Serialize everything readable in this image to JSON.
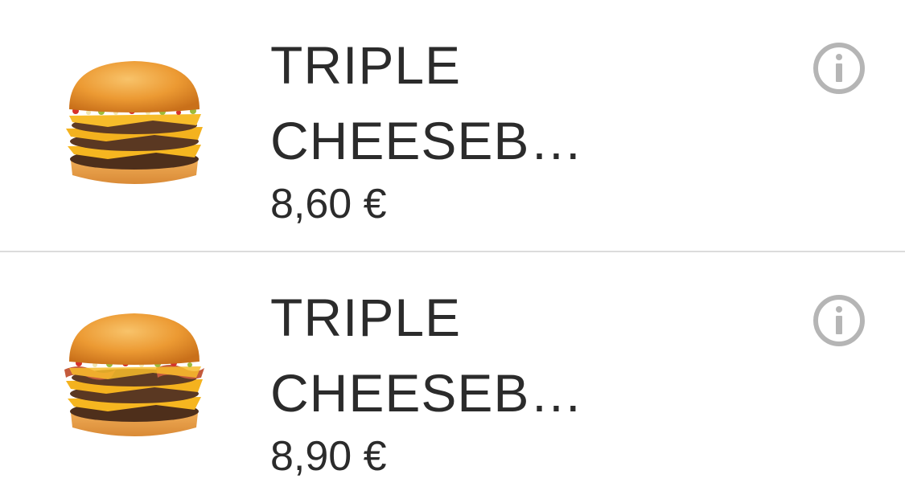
{
  "items": [
    {
      "name": "TRIPLE\nCHEESEB…",
      "price": "8,60 €",
      "image_icon": "triple-cheeseburger-image",
      "info_icon": "info-icon"
    },
    {
      "name": "TRIPLE\nCHEESEB…",
      "price": "8,90 €",
      "image_icon": "triple-cheeseburger-bacon-image",
      "info_icon": "info-icon"
    }
  ],
  "colors": {
    "text": "#2b2b2b",
    "info_icon": "#b5b5b5",
    "divider": "#dcdcdc",
    "bun": "#e9962d",
    "cheese": "#f4b21e",
    "patty": "#5a3822"
  }
}
